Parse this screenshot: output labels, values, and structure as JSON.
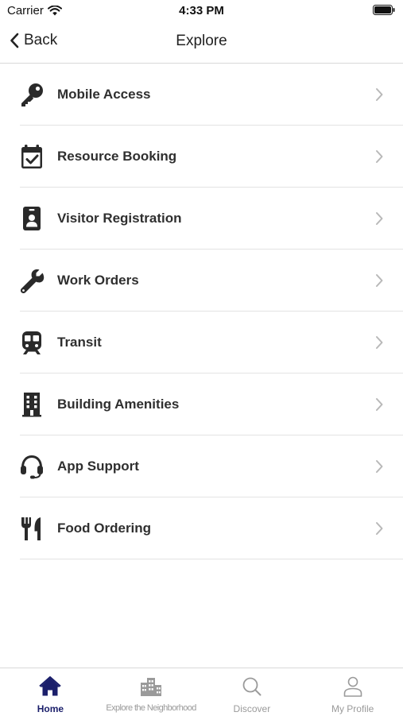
{
  "status_bar": {
    "carrier": "Carrier",
    "time": "4:33 PM"
  },
  "nav": {
    "back_label": "Back",
    "title": "Explore"
  },
  "menu": {
    "items": [
      {
        "label": "Mobile Access",
        "icon": "key-icon"
      },
      {
        "label": "Resource Booking",
        "icon": "calendar-check-icon"
      },
      {
        "label": "Visitor Registration",
        "icon": "id-badge-icon"
      },
      {
        "label": "Work Orders",
        "icon": "wrench-icon"
      },
      {
        "label": "Transit",
        "icon": "train-icon"
      },
      {
        "label": "Building Amenities",
        "icon": "building-icon"
      },
      {
        "label": "App Support",
        "icon": "headset-icon"
      },
      {
        "label": "Food Ordering",
        "icon": "utensils-icon"
      }
    ]
  },
  "tabs": {
    "items": [
      {
        "label": "Home",
        "icon": "home-icon",
        "active": true
      },
      {
        "label": "Explore the Neighborhood",
        "icon": "city-icon",
        "active": false
      },
      {
        "label": "Discover",
        "icon": "search-icon",
        "active": false
      },
      {
        "label": "My Profile",
        "icon": "user-icon",
        "active": false
      }
    ]
  },
  "colors": {
    "active_tab": "#1b1f6b",
    "inactive_tab": "#9a9a9a",
    "icon": "#2a2a2a",
    "chevron": "#b8b8b8",
    "divider": "#e3e3e3"
  }
}
